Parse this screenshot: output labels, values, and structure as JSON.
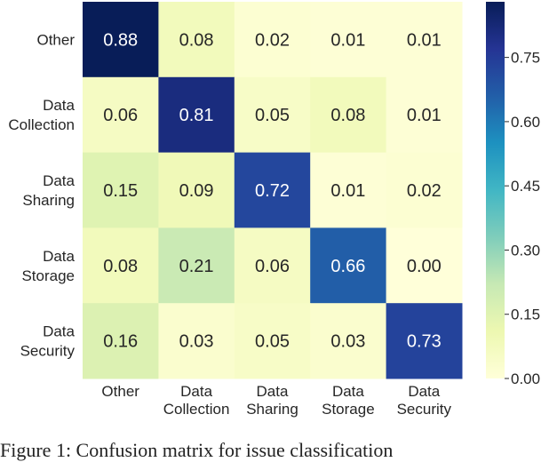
{
  "chart_data": {
    "type": "heatmap",
    "title": "",
    "xlabel": "",
    "ylabel": "",
    "x_categories": [
      [
        "Other"
      ],
      [
        "Data",
        "Collection"
      ],
      [
        "Data",
        "Sharing"
      ],
      [
        "Data",
        "Storage"
      ],
      [
        "Data",
        "Security"
      ]
    ],
    "y_categories": [
      [
        "Other"
      ],
      [
        "Data",
        "Collection"
      ],
      [
        "Data",
        "Sharing"
      ],
      [
        "Data",
        "Storage"
      ],
      [
        "Data",
        "Security"
      ]
    ],
    "values": [
      [
        0.88,
        0.08,
        0.02,
        0.01,
        0.01
      ],
      [
        0.06,
        0.81,
        0.05,
        0.08,
        0.01
      ],
      [
        0.15,
        0.09,
        0.72,
        0.01,
        0.02
      ],
      [
        0.08,
        0.21,
        0.06,
        0.66,
        0.0
      ],
      [
        0.16,
        0.03,
        0.05,
        0.03,
        0.73
      ]
    ],
    "colormap": "YlGnBu",
    "color_range": [
      0.0,
      0.88
    ],
    "colorbar_ticks": [
      "0.00",
      "0.15",
      "0.30",
      "0.45",
      "0.60",
      "0.75"
    ],
    "colorbar_tick_values": [
      0.0,
      0.15,
      0.3,
      0.45,
      0.6,
      0.75
    ],
    "colors": {
      "text_dark": "#262626",
      "text_light": "#ffffff",
      "ylgnbu_stops": [
        "#ffffd9",
        "#edf8b1",
        "#c7e9b4",
        "#7fcdbb",
        "#41b6c4",
        "#1d91c0",
        "#225ea8",
        "#253494",
        "#081d58"
      ]
    }
  },
  "caption": "Figure 1: Confusion matrix for issue classification"
}
